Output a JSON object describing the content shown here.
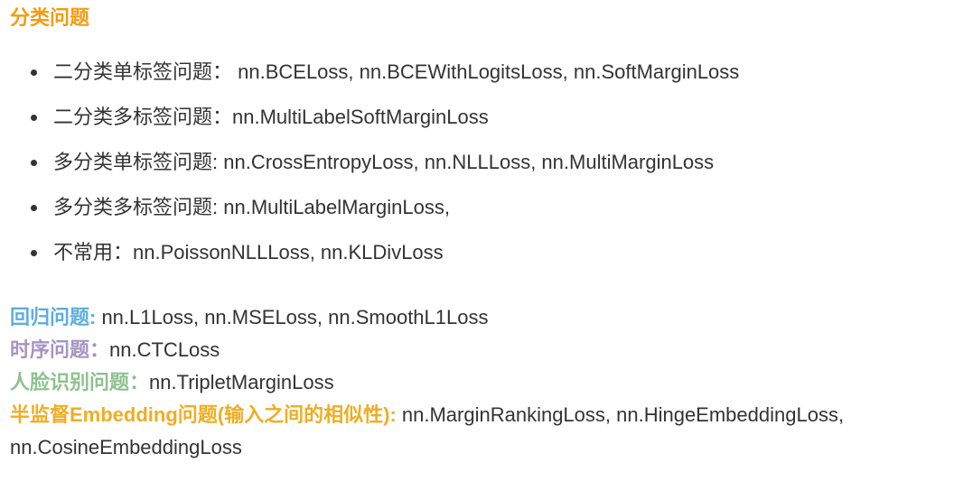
{
  "title": {
    "text": "分类问题",
    "color": "#f39c12"
  },
  "list": [
    {
      "label": "二分类单标签问题：",
      "losses": " nn.BCELoss, nn.BCEWithLogitsLoss, nn.SoftMarginLoss"
    },
    {
      "label": "二分类多标签问题：",
      "losses": "nn.MultiLabelSoftMarginLoss"
    },
    {
      "label": "多分类单标签问题:",
      "losses": " nn.CrossEntropyLoss, nn.NLLLoss, nn.MultiMarginLoss"
    },
    {
      "label": "多分类多标签问题:",
      "losses": " nn.MultiLabelMarginLoss,"
    },
    {
      "label": "不常用：",
      "losses": "nn.PoissonNLLLoss, nn.KLDivLoss"
    }
  ],
  "sections": [
    {
      "label": "回归问题:",
      "value": " nn.L1Loss, nn.MSELoss, nn.SmoothL1Loss",
      "color": "#5dade2"
    },
    {
      "label": "时序问题：",
      "value": "nn.CTCLoss",
      "color": "#a593c4"
    },
    {
      "label": "人脸识别问题：",
      "value": "nn.TripletMarginLoss",
      "color": "#8fc18f"
    },
    {
      "label": "半监督Embedding问题(输入之间的相似性):",
      "value": " nn.MarginRankingLoss, nn.HingeEmbeddingLoss,",
      "color": "#f0ad23"
    },
    {
      "label": "",
      "value": "nn.CosineEmbeddingLoss",
      "color": "#333333"
    }
  ]
}
